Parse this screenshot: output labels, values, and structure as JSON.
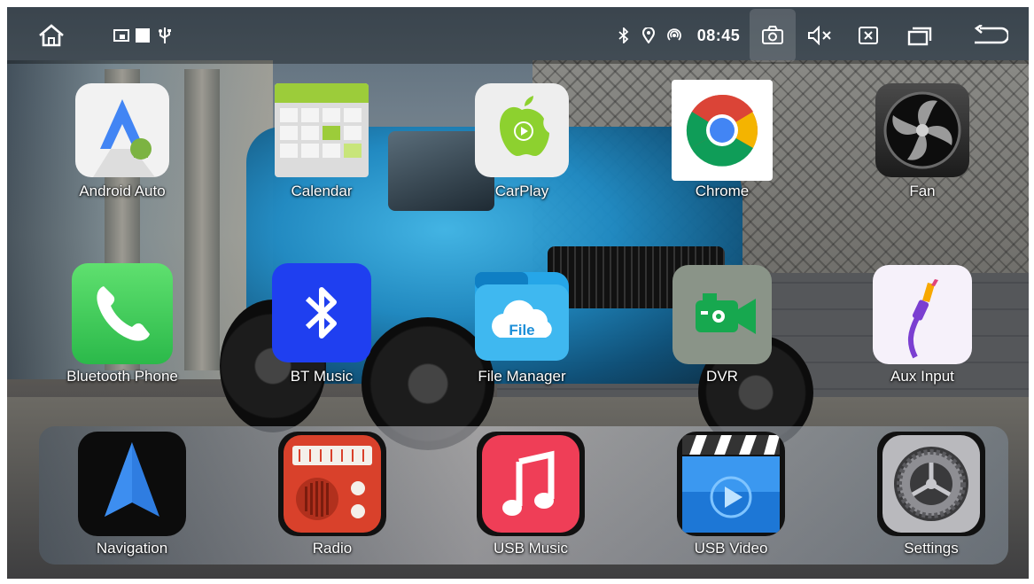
{
  "status_bar": {
    "time": "08:45",
    "icons": [
      "home-icon",
      "screen-cast-icon",
      "square-icon",
      "usb-icon",
      "bluetooth-icon",
      "location-icon",
      "signal-icon",
      "camera-icon",
      "mute-icon",
      "close-window-icon",
      "recent-apps-icon",
      "back-icon"
    ]
  },
  "apps_row1": [
    {
      "label": "Android Auto",
      "icon": "android-auto-icon"
    },
    {
      "label": "Calendar",
      "icon": "calendar-icon"
    },
    {
      "label": "CarPlay",
      "icon": "carplay-icon"
    },
    {
      "label": "Chrome",
      "icon": "chrome-icon"
    },
    {
      "label": "Fan",
      "icon": "fan-icon"
    }
  ],
  "apps_row2": [
    {
      "label": "Bluetooth Phone",
      "icon": "phone-icon"
    },
    {
      "label": "BT Music",
      "icon": "bluetooth-icon"
    },
    {
      "label": "File Manager",
      "icon": "file-manager-icon"
    },
    {
      "label": "DVR",
      "icon": "dvr-camera-icon"
    },
    {
      "label": "Aux Input",
      "icon": "aux-cable-icon"
    }
  ],
  "dock": [
    {
      "label": "Navigation",
      "icon": "navigation-arrow-icon"
    },
    {
      "label": "Radio",
      "icon": "radio-icon"
    },
    {
      "label": "USB Music",
      "icon": "music-note-icon"
    },
    {
      "label": "USB Video",
      "icon": "video-clapper-icon"
    },
    {
      "label": "Settings",
      "icon": "settings-gear-icon"
    }
  ],
  "file_manager_badge": "File",
  "colors": {
    "android_auto": "#f2f2f2",
    "carplay_green": "#8dd12f",
    "phone_green": "#34c759",
    "bluetooth_blue": "#1f3ff0",
    "music_red": "#ef3e57",
    "radio_red": "#d9412b",
    "nav_blue": "#2f7de1"
  }
}
